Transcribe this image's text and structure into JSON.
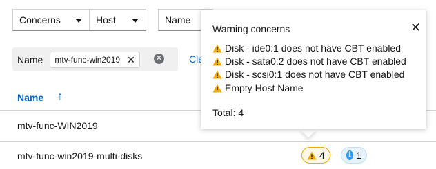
{
  "toolbar": {
    "filter_attribute": "Concerns",
    "filter_value": "Host",
    "search_attribute": "Name"
  },
  "filters": {
    "category": "Name",
    "chip_value": "mtv-func-win2019",
    "clear_label": "Cle"
  },
  "table": {
    "column_name": "Name",
    "rows": [
      {
        "name": "mtv-func-WIN2019"
      },
      {
        "name": "mtv-func-win2019-multi-disks",
        "warning_count": "4",
        "info_count": "1"
      }
    ]
  },
  "popover": {
    "title": "Warning concerns",
    "items": [
      "Disk - ide0:1 does not have CBT enabled",
      "Disk - sata0:2 does not have CBT enabled",
      "Disk - scsi0:1 does not have CBT enabled",
      "Empty Host Name"
    ],
    "total": "Total: 4"
  },
  "colors": {
    "link": "#0066cc",
    "warning": "#f0ab00",
    "info": "#2b9af3"
  }
}
